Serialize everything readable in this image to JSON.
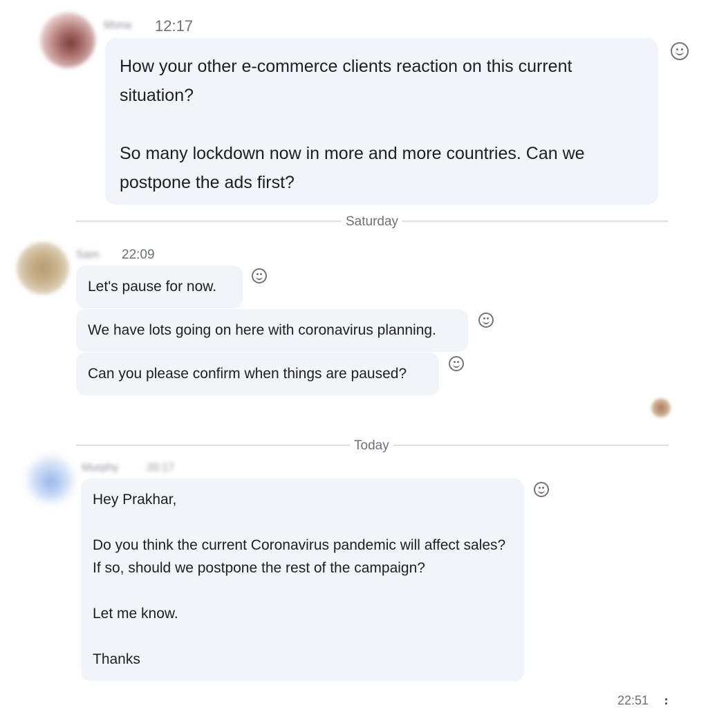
{
  "messages": [
    {
      "sender": "Mona",
      "time": "12:17",
      "paragraphs": [
        [
          "How your other e-commerce clients reaction on this current",
          "situation?"
        ],
        [
          "So many lockdown now in more and more countries. Can we",
          "postpone the ads first?"
        ]
      ]
    }
  ],
  "divider_saturday": "Saturday",
  "second_sender": {
    "name": "Sam",
    "time": "22:09",
    "messages": [
      "Let's pause for now.",
      "We have lots going on here with coronavirus planning.",
      "Can you please confirm when things are paused?"
    ]
  },
  "divider_today": "Today",
  "third_sender": {
    "name": "Murphy",
    "time": "20:17",
    "lines": {
      "greeting": "Hey Prakhar,",
      "q1": "Do you think the current Coronavirus pandemic will affect sales?",
      "q2": "If so, should we postpone the rest of the campaign?",
      "ask": "Let me know.",
      "signoff": "Thanks"
    },
    "footer_time": "22:51"
  },
  "icons": {
    "reaction": "smiley-face-icon",
    "more": "more-vertical-icon"
  }
}
